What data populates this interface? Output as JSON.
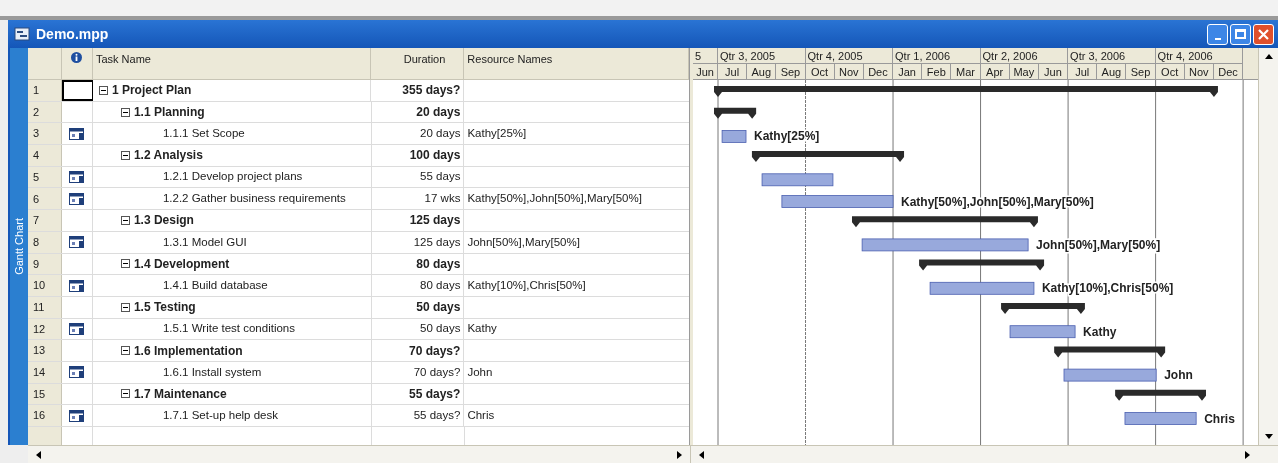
{
  "window": {
    "title": "Demo.mpp"
  },
  "view_bar": {
    "label": "Gantt Chart"
  },
  "table": {
    "columns": [
      "Task Name",
      "Duration",
      "Resource Names"
    ],
    "rows": [
      {
        "id": "1",
        "name": "1 Project Plan",
        "duration": "355 days?",
        "kind": "summary",
        "expanded": true,
        "selected": true,
        "children": [
          {
            "id": "2",
            "name": "1.1 Planning",
            "duration": "20 days",
            "kind": "summary",
            "expanded": true,
            "selected": false,
            "children": [
              {
                "id": "3",
                "name": "1.1.1 Set Scope",
                "duration": "20 days",
                "resources": "Kathy[25%]",
                "kind": "task",
                "selected": false
              }
            ]
          },
          {
            "id": "4",
            "name": "1.2 Analysis",
            "duration": "100 days",
            "kind": "summary",
            "expanded": true,
            "selected": false,
            "children": [
              {
                "id": "5",
                "name": "1.2.1 Develop project plans",
                "duration": "55 days",
                "kind": "task",
                "selected": false
              },
              {
                "id": "6",
                "name": "1.2.2 Gather business requirements",
                "duration": "17 wks",
                "resources": "Kathy[50%],John[50%],Mary[50%]",
                "kind": "task",
                "selected": false
              }
            ]
          },
          {
            "id": "7",
            "name": "1.3 Design",
            "duration": "125 days",
            "kind": "summary",
            "expanded": true,
            "selected": false,
            "children": [
              {
                "id": "8",
                "name": "1.3.1 Model GUI",
                "duration": "125 days",
                "resources": "John[50%],Mary[50%]",
                "kind": "task",
                "selected": false
              }
            ]
          },
          {
            "id": "9",
            "name": "1.4 Development",
            "duration": "80 days",
            "kind": "summary",
            "expanded": true,
            "selected": false,
            "children": [
              {
                "id": "10",
                "name": "1.4.1 Build database",
                "duration": "80 days",
                "resources": "Kathy[10%],Chris[50%]",
                "kind": "task",
                "selected": false
              }
            ]
          },
          {
            "id": "11",
            "name": "1.5 Testing",
            "duration": "50 days",
            "kind": "summary",
            "expanded": true,
            "selected": false,
            "children": [
              {
                "id": "12",
                "name": "1.5.1 Write test conditions",
                "duration": "50 days",
                "resources": "Kathy",
                "kind": "task",
                "selected": false
              }
            ]
          },
          {
            "id": "13",
            "name": "1.6 Implementation",
            "duration": "70 days?",
            "kind": "summary",
            "expanded": true,
            "selected": false,
            "children": [
              {
                "id": "14",
                "name": "1.6.1 Install system",
                "duration": "70 days?",
                "resources": "John",
                "kind": "task",
                "selected": false
              }
            ]
          },
          {
            "id": "15",
            "name": "1.7 Maintenance",
            "duration": "55 days?",
            "kind": "summary",
            "expanded": true,
            "selected": false,
            "children": [
              {
                "id": "16",
                "name": "1.7.1 Set-up help desk",
                "duration": "55 days?",
                "resources": "Chris",
                "kind": "task",
                "selected": false
              }
            ]
          }
        ]
      }
    ]
  },
  "timescale": {
    "quarters": [
      "5",
      "Qtr 3, 2005",
      "Qtr 4, 2005",
      "Qtr 1, 2006",
      "Qtr 2, 2006",
      "Qtr 3, 2006",
      "Qtr 4, 2006"
    ],
    "months": [
      "Jun",
      "Jul",
      "Aug",
      "Sep",
      "Oct",
      "Nov",
      "Dec",
      "Jan",
      "Feb",
      "Mar",
      "Apr",
      "May",
      "Jun",
      "Jul",
      "Aug",
      "Sep",
      "Oct",
      "Nov",
      "Dec"
    ]
  },
  "gantt": {
    "bar_labels": [
      "Kathy[25%]",
      "Kathy[50%],John[50%],Mary[50%]",
      "John[50%],Mary[50%]",
      "Kathy[10%],Chris[50%]",
      "Kathy",
      "John",
      "Chris"
    ]
  }
}
